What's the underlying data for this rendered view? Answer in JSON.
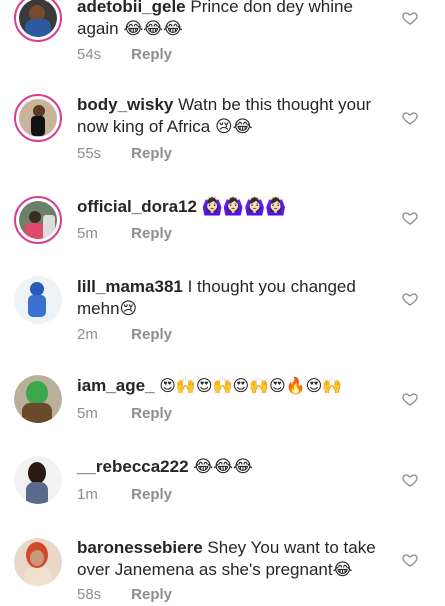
{
  "comments": [
    {
      "username": "adetobii_gele",
      "text": "Prince don dey whine",
      "text2": "again 😂😂😂",
      "time": "54s",
      "reply": "Reply"
    },
    {
      "username": "body_wisky",
      "text": "Watn be this thought your",
      "text2": "now king of Africa 😢😂",
      "time": "55s",
      "reply": "Reply"
    },
    {
      "username": "official_dora12",
      "text": "🙆🏻‍♀️🙆🏻‍♀️🙆🏻‍♀️🙆🏻‍♀️",
      "text2": "",
      "time": "5m",
      "reply": "Reply"
    },
    {
      "username": "lill_mama381",
      "text": "I thought you changed",
      "text2": "mehn😢",
      "time": "2m",
      "reply": "Reply"
    },
    {
      "username": "iam_age_",
      "text": "😍🙌😍🙌😍🙌😍🔥😍🙌",
      "text2": "",
      "time": "5m",
      "reply": "Reply"
    },
    {
      "username": "__rebecca222",
      "text": "😂😂😂",
      "text2": "",
      "time": "1m",
      "reply": "Reply"
    },
    {
      "username": "baronessebiere",
      "text": "Shey You want to take",
      "text2": "over Janemena as she's pregnant😂",
      "time": "58s",
      "reply": "Reply"
    }
  ],
  "icons": {
    "like": "heart-outline-icon"
  },
  "colors": {
    "story_ring": "#d8408f",
    "muted": "#8e8e8e",
    "text": "#262626"
  }
}
